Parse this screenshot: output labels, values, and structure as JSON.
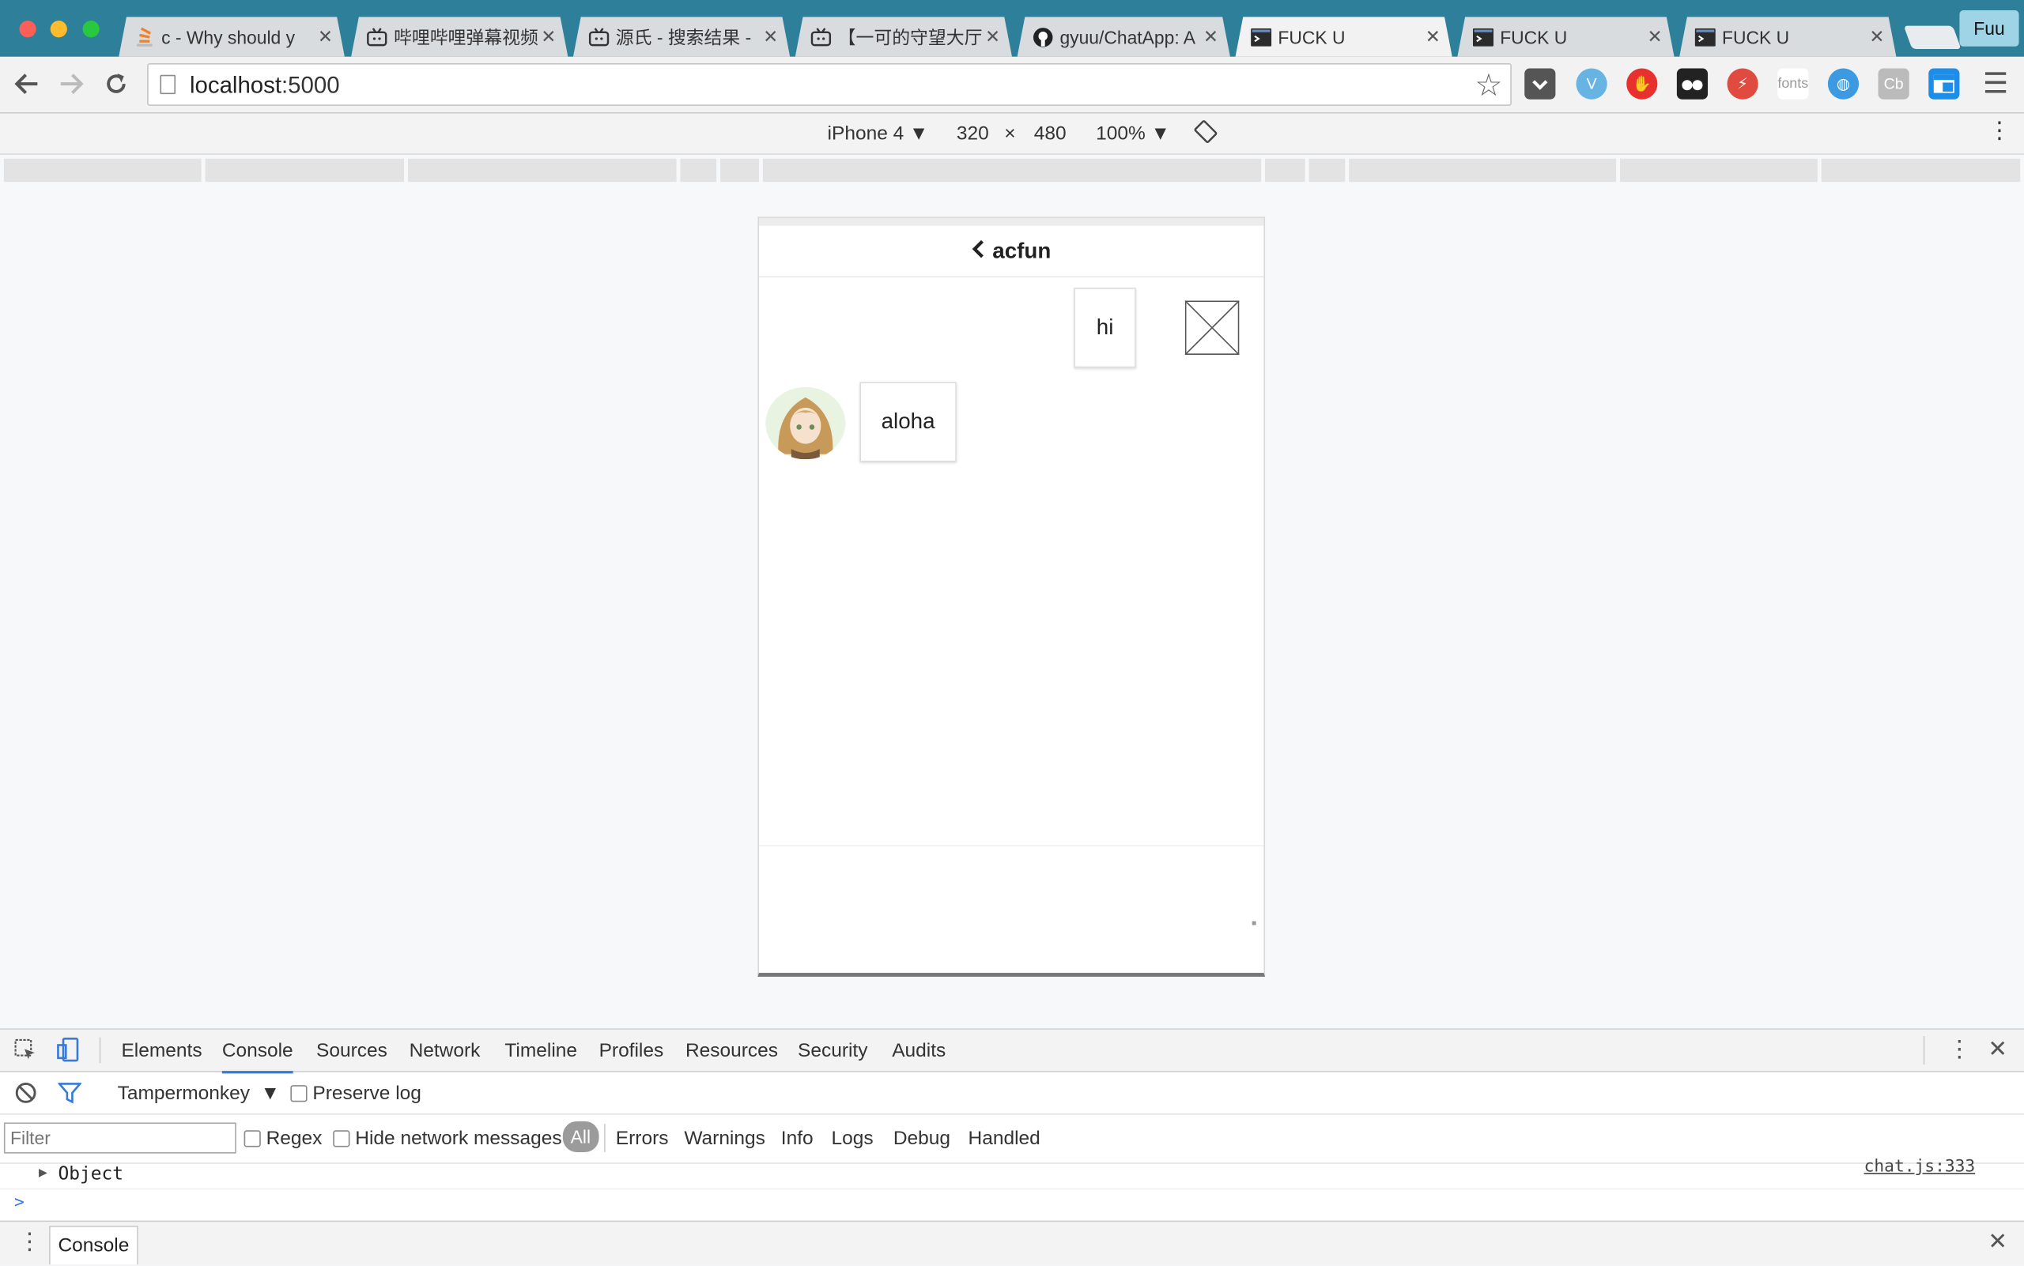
{
  "browser": {
    "tabs": [
      {
        "title": "c - Why should y",
        "icon": "stackoverflow-icon"
      },
      {
        "title": "哔哩哔哩弹幕视频",
        "icon": "bilibili-icon"
      },
      {
        "title": "源氏 - 搜索结果 -",
        "icon": "bilibili-icon"
      },
      {
        "title": "【一可的守望大厅",
        "icon": "bilibili-icon"
      },
      {
        "title": "gyuu/ChatApp: A",
        "icon": "github-icon"
      },
      {
        "title": "FUCK U",
        "icon": "terminal-icon",
        "active": true
      },
      {
        "title": "FUCK U",
        "icon": "terminal-icon"
      },
      {
        "title": "FUCK U",
        "icon": "terminal-icon"
      }
    ],
    "profile_label": "Fuu",
    "url_host": "localhost",
    "url_port": ":5000",
    "extensions": {
      "fonts_label": "fonts",
      "cb_label": "Cb"
    }
  },
  "device_toolbar": {
    "device": "iPhone 4",
    "width": "320",
    "times": "×",
    "height": "480",
    "zoom": "100%"
  },
  "chat": {
    "title": "acfun",
    "messages": [
      {
        "side": "right",
        "text": "hi"
      },
      {
        "side": "left",
        "text": "aloha"
      }
    ]
  },
  "devtools": {
    "tabs": [
      "Elements",
      "Console",
      "Sources",
      "Network",
      "Timeline",
      "Profiles",
      "Resources",
      "Security",
      "Audits"
    ],
    "active_tab": "Console",
    "context": "Tampermonkey",
    "preserve_log": "Preserve log",
    "filter_placeholder": "Filter",
    "regex": "Regex",
    "hide_network": "Hide network messages",
    "levels": [
      "All",
      "Errors",
      "Warnings",
      "Info",
      "Logs",
      "Debug",
      "Handled"
    ],
    "log_entry": "Object",
    "log_source": "chat.js:333",
    "prompt": ">",
    "drawer_tab": "Console"
  }
}
